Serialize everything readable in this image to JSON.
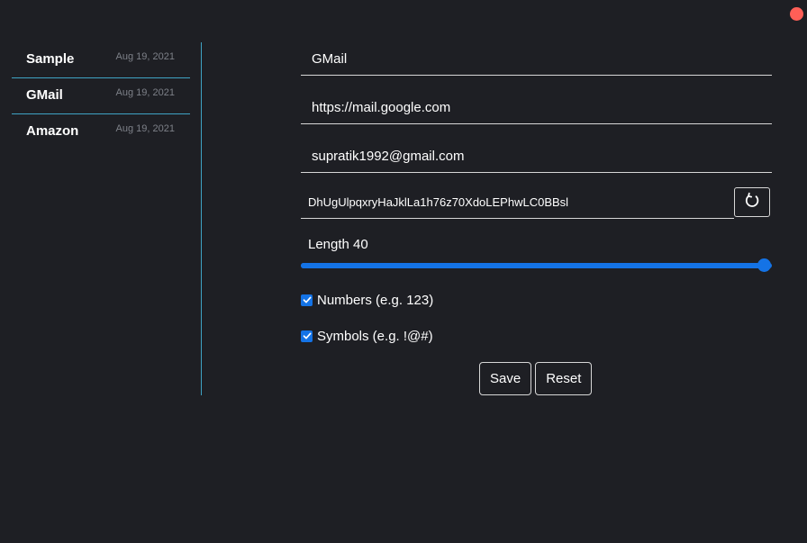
{
  "window": {
    "close_color": "#ff5f57"
  },
  "sidebar": {
    "items": [
      {
        "name": "Sample",
        "date": "Aug 19, 2021"
      },
      {
        "name": "GMail",
        "date": "Aug 19, 2021"
      },
      {
        "name": "Amazon",
        "date": "Aug 19, 2021"
      }
    ]
  },
  "form": {
    "title_value": "GMail",
    "url_value": "https://mail.google.com",
    "username_value": "supratik1992@gmail.com",
    "password_value": "DhUgUlpqxryHaJklLa1h76z70XdoLEPhwLC0BBsl",
    "regenerate_icon": "refresh-icon",
    "length_label": "Length 40",
    "length": 40,
    "length_min": 8,
    "length_max": 40,
    "numbers_label": "Numbers (e.g. 123)",
    "numbers_checked": true,
    "symbols_label": "Symbols (e.g. !@#)",
    "symbols_checked": true,
    "save_label": "Save",
    "reset_label": "Reset"
  },
  "colors": {
    "accent": "#1473e6",
    "divider": "#3fa3c4",
    "background": "#1e1f24"
  }
}
